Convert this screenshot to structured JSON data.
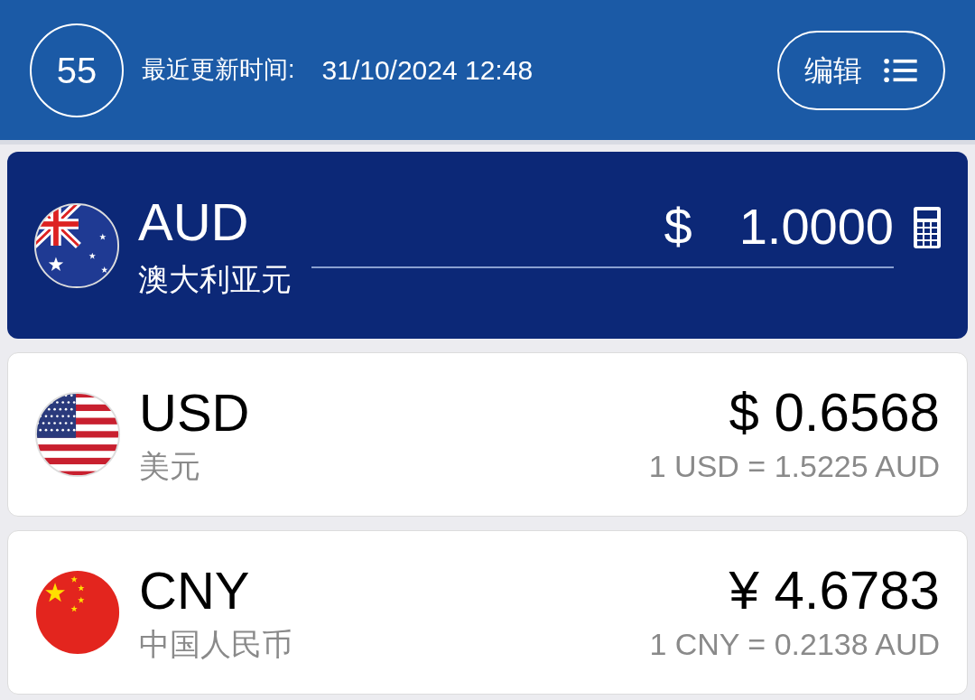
{
  "header": {
    "countdown": "55",
    "updated_label": "最近更新时间:",
    "updated_time": "31/10/2024 12:48",
    "edit_button": "编辑"
  },
  "base": {
    "code": "AUD",
    "name": "澳大利亚元",
    "symbol": "$",
    "amount": "1.0000"
  },
  "rates": [
    {
      "code": "USD",
      "name": "美元",
      "amount": "$ 0.6568",
      "rate": "1 USD = 1.5225 AUD"
    },
    {
      "code": "CNY",
      "name": "中国人民币",
      "amount": "¥ 4.6783",
      "rate": "1 CNY = 0.2138 AUD"
    }
  ]
}
